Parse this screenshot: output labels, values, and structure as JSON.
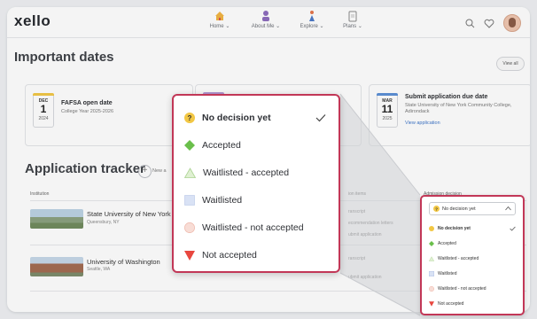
{
  "app": {
    "logo": "xello"
  },
  "nav": [
    {
      "label": "Home",
      "icon": "house-icon"
    },
    {
      "label": "About Me",
      "icon": "person-icon"
    },
    {
      "label": "Explore",
      "icon": "explorer-icon"
    },
    {
      "label": "Plans",
      "icon": "clipboard-icon"
    }
  ],
  "header_icons": [
    "search-icon",
    "heart-icon",
    "avatar"
  ],
  "important_dates": {
    "title": "Important dates",
    "view_all": "View all",
    "cards": [
      {
        "month": "DEC",
        "day": "1",
        "year": "2024",
        "title": "FAFSA open date",
        "subtitle": "College Year 2025-2026",
        "accent": "#f2c744"
      },
      {
        "month": "MAR",
        "day": "11",
        "year": "2025",
        "title": "Submit application due date",
        "subtitle": "State University of New York Community College, Adirondack",
        "link": "View application",
        "accent": "#5b8fd6"
      }
    ]
  },
  "tracker": {
    "title": "Application tracker",
    "add_label": "New a",
    "columns": [
      "Institution",
      "ion items",
      "Admission decision"
    ],
    "rows": [
      {
        "name": "State University of New York",
        "location": "Queensbury, NY",
        "items": [
          "ranscript",
          "ecommendation letters",
          "ubmit application"
        ]
      },
      {
        "name": "University of Washington",
        "location": "Seattle, WA",
        "items": [
          "ranscript",
          "ubmit application"
        ]
      }
    ]
  },
  "decision_dropdown": {
    "selected": "No decision yet",
    "options": [
      {
        "label": "No decision yet",
        "icon": "question-icon",
        "color": "#f2c744"
      },
      {
        "label": "Accepted",
        "icon": "diamond-icon",
        "color": "#6abf4b"
      },
      {
        "label": "Waitlisted - accepted",
        "icon": "triangle-outline-icon",
        "color": "#c9e3b8"
      },
      {
        "label": "Waitlisted",
        "icon": "square-icon",
        "color": "#d9e2f5"
      },
      {
        "label": "Waitlisted - not accepted",
        "icon": "circle-icon",
        "color": "#f6d4cc"
      },
      {
        "label": "Not accepted",
        "icon": "down-triangle-icon",
        "color": "#e8473f"
      }
    ]
  },
  "colors": {
    "highlight": "#c23757",
    "link": "#3c74c8"
  }
}
